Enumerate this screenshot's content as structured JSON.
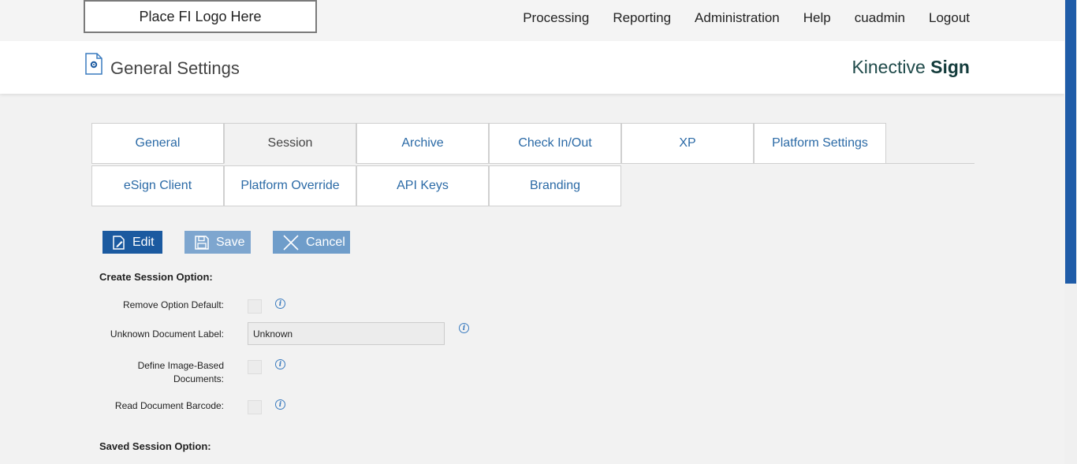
{
  "topbar": {
    "logo_text": "Place FI Logo Here",
    "nav": [
      "Processing",
      "Reporting",
      "Administration",
      "Help",
      "cuadmin",
      "Logout"
    ]
  },
  "header": {
    "title": "General Settings",
    "brand_light": "Kinective",
    "brand_bold": "Sign"
  },
  "tabs": {
    "row1": [
      "General",
      "Session",
      "Archive",
      "Check In/Out",
      "XP",
      "Platform Settings"
    ],
    "row2": [
      "eSign Client",
      "Platform Override",
      "API Keys",
      "Branding"
    ],
    "active": "Session"
  },
  "toolbar": {
    "edit_label": "Edit",
    "save_label": "Save",
    "cancel_label": "Cancel"
  },
  "form": {
    "create_section": "Create Session Option:",
    "remove_option_default": "Remove Option Default:",
    "unknown_document_label": "Unknown Document Label:",
    "unknown_document_value": "Unknown",
    "define_image_based": "Define Image-Based Documents:",
    "read_document_barcode": "Read Document Barcode:",
    "saved_section": "Saved Session Option:"
  },
  "icons": {
    "info": "i"
  },
  "colors": {
    "accent": "#1b5aa0",
    "tab_text": "#2b6aa6",
    "brand": "#1f4a4a"
  }
}
